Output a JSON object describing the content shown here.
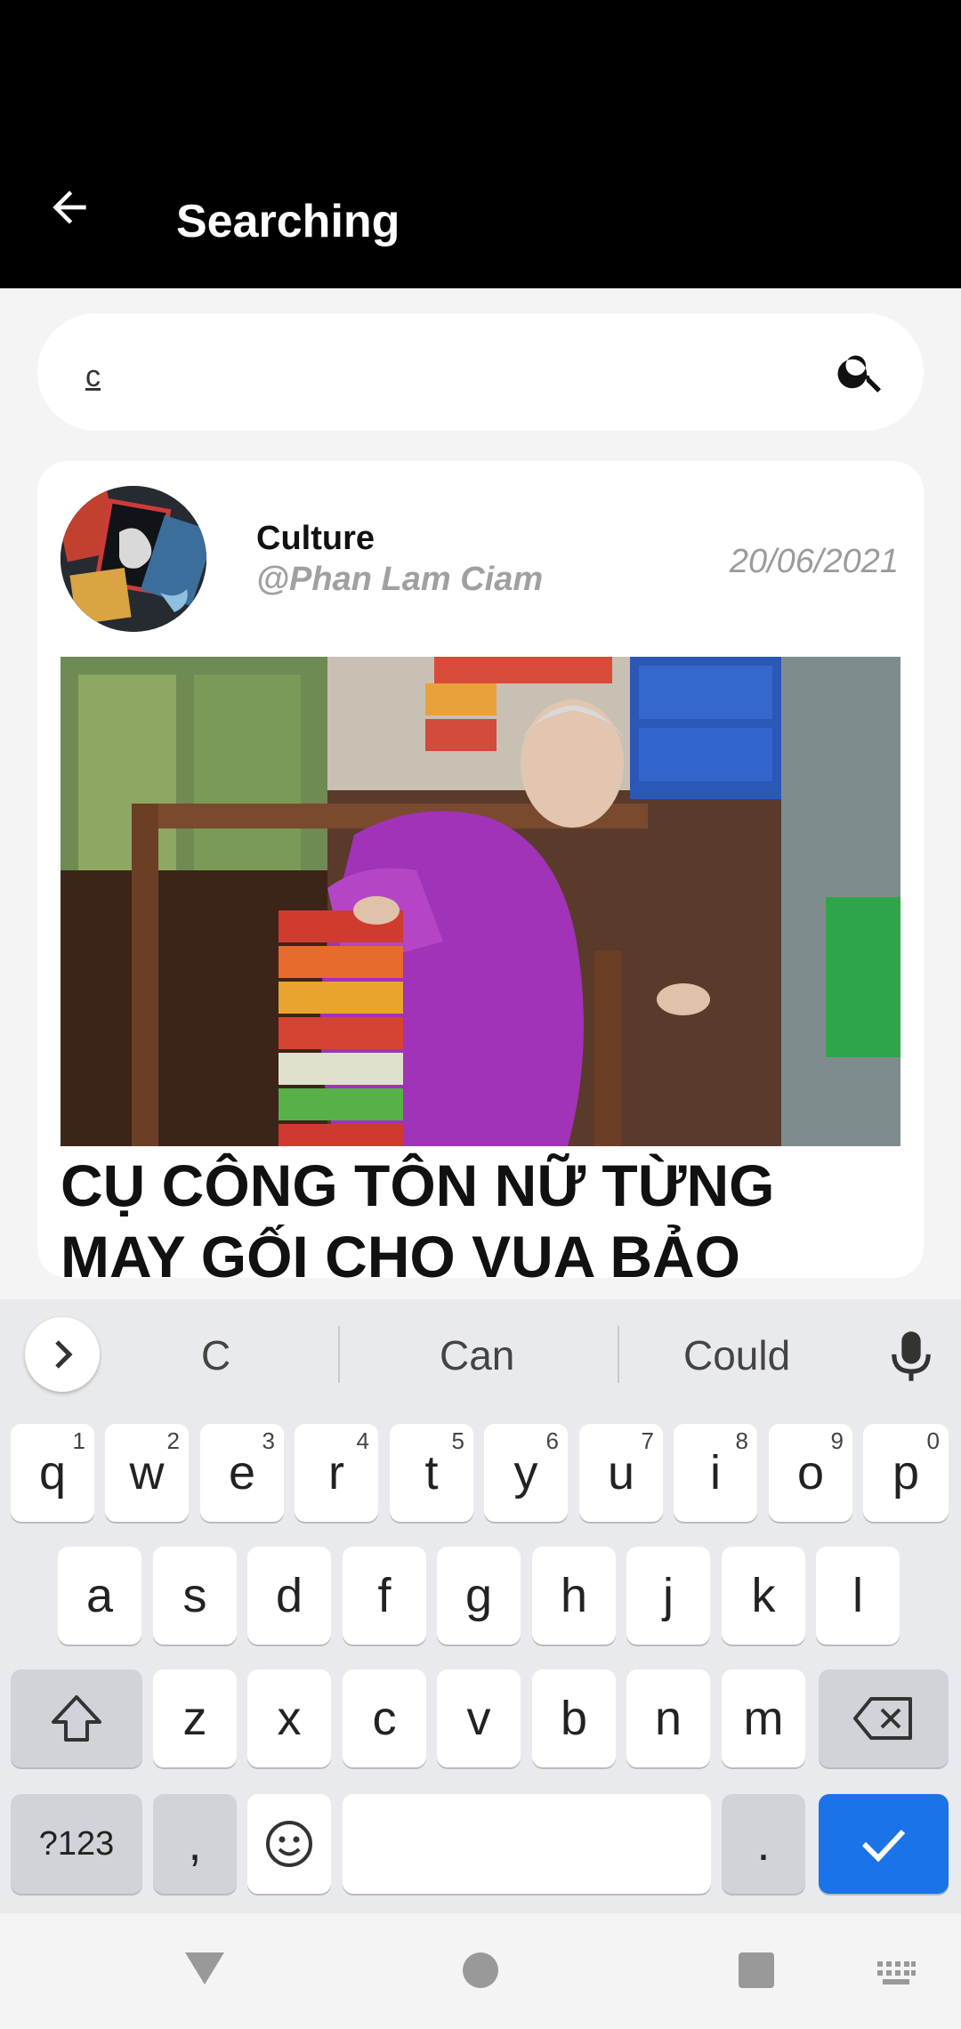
{
  "appbar": {
    "title": "Searching"
  },
  "search": {
    "value": "c"
  },
  "result": {
    "category": "Culture",
    "author": "@Phan Lam Ciam",
    "date": "20/06/2021",
    "headline": "CỤ CÔNG TÔN NỮ TỪNG MAY GỐI CHO VUA BẢO"
  },
  "keyboard": {
    "suggestions": [
      "C",
      "Can",
      "Could"
    ],
    "row1": [
      {
        "k": "q",
        "h": "1"
      },
      {
        "k": "w",
        "h": "2"
      },
      {
        "k": "e",
        "h": "3"
      },
      {
        "k": "r",
        "h": "4"
      },
      {
        "k": "t",
        "h": "5"
      },
      {
        "k": "y",
        "h": "6"
      },
      {
        "k": "u",
        "h": "7"
      },
      {
        "k": "i",
        "h": "8"
      },
      {
        "k": "o",
        "h": "9"
      },
      {
        "k": "p",
        "h": "0"
      }
    ],
    "row2": [
      "a",
      "s",
      "d",
      "f",
      "g",
      "h",
      "j",
      "k",
      "l"
    ],
    "row3": [
      "z",
      "x",
      "c",
      "v",
      "b",
      "n",
      "m"
    ],
    "symbols_label": "?123",
    "comma": ",",
    "period": "."
  },
  "colors": {
    "enter_key": "#1a73e8",
    "appbar": "#000000"
  }
}
